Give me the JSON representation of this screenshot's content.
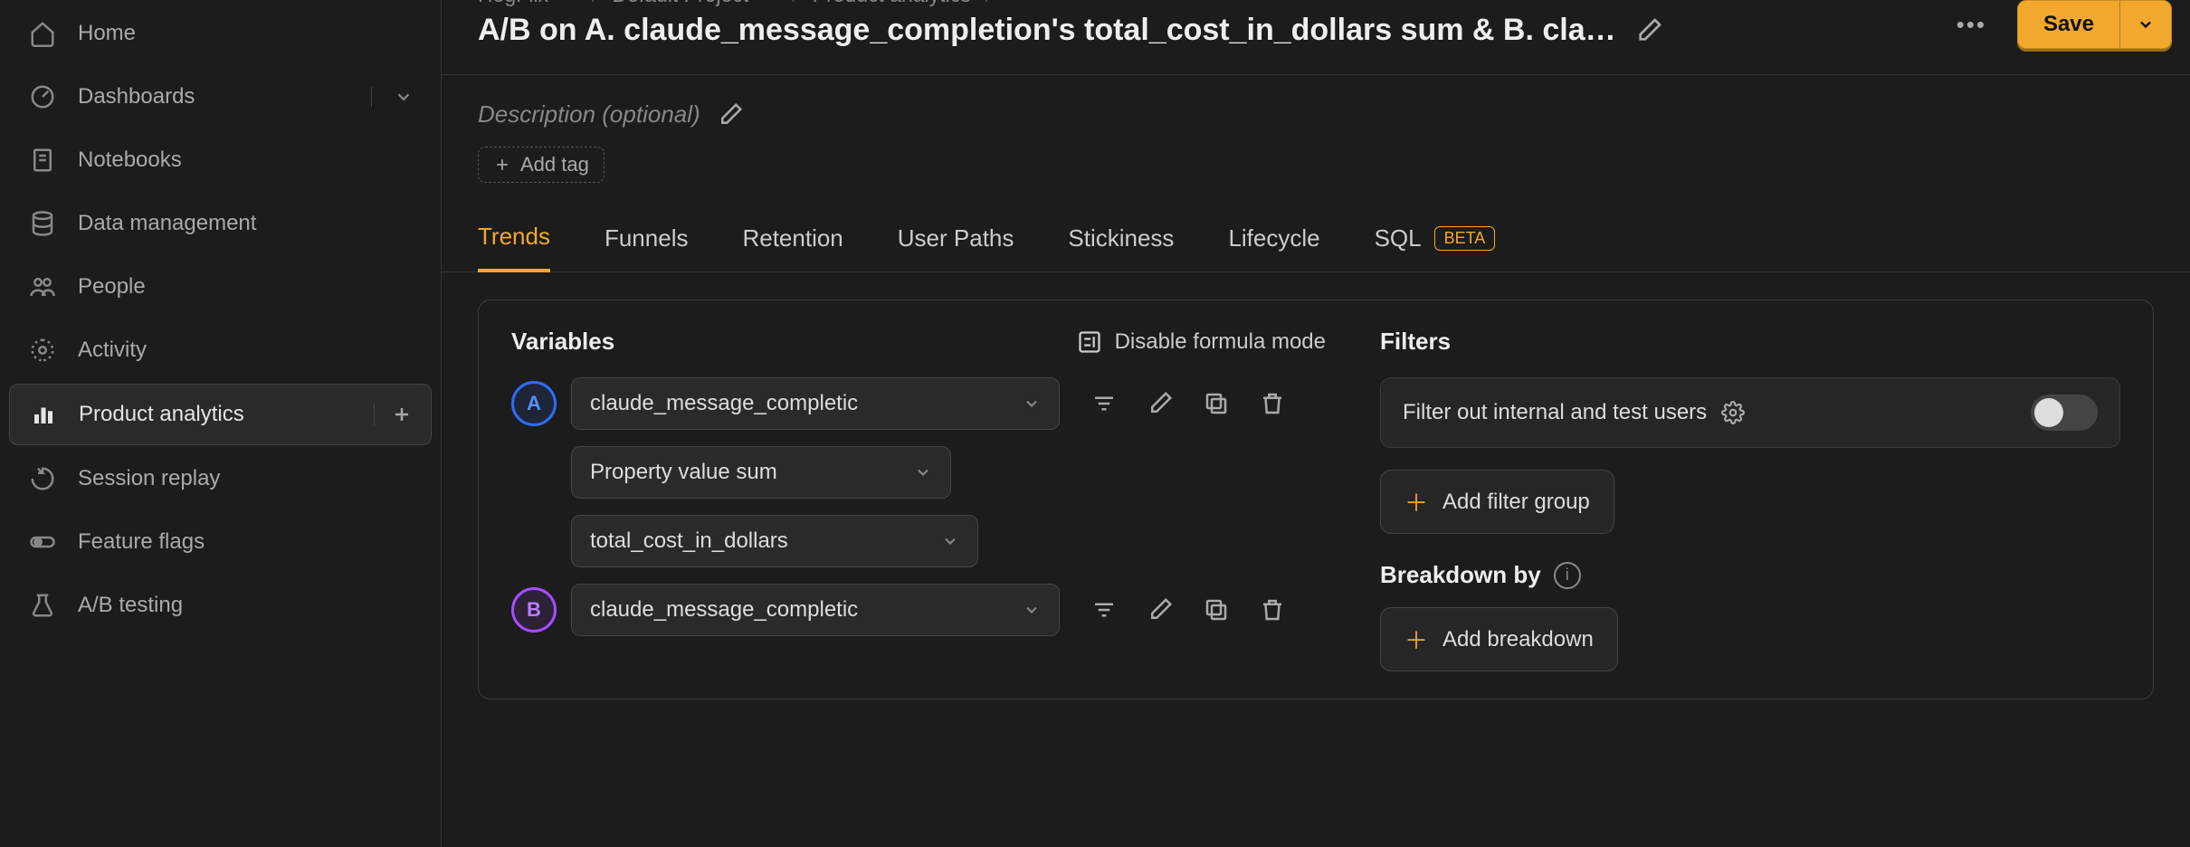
{
  "sidebar": {
    "items": [
      {
        "label": "Home"
      },
      {
        "label": "Dashboards"
      },
      {
        "label": "Notebooks"
      },
      {
        "label": "Data management"
      },
      {
        "label": "People"
      },
      {
        "label": "Activity"
      },
      {
        "label": "Product analytics"
      },
      {
        "label": "Session replay"
      },
      {
        "label": "Feature flags"
      },
      {
        "label": "A/B testing"
      }
    ]
  },
  "breadcrumb": {
    "org": "HogFlix",
    "project": "Default Project",
    "section": "Product analytics"
  },
  "title": "A/B on A. claude_message_completion's total_cost_in_dollars sum & B. cla…",
  "save_label": "Save",
  "description_placeholder": "Description (optional)",
  "add_tag_label": "Add tag",
  "tabs": [
    {
      "label": "Trends",
      "active": true
    },
    {
      "label": "Funnels"
    },
    {
      "label": "Retention"
    },
    {
      "label": "User Paths"
    },
    {
      "label": "Stickiness"
    },
    {
      "label": "Lifecycle"
    },
    {
      "label": "SQL",
      "badge": "BETA"
    }
  ],
  "variables": {
    "title": "Variables",
    "formula_toggle": "Disable formula mode",
    "series": [
      {
        "letter": "A",
        "event": "claude_message_completic",
        "aggregation": "Property value sum",
        "property": "total_cost_in_dollars"
      },
      {
        "letter": "B",
        "event": "claude_message_completic"
      }
    ]
  },
  "filters": {
    "title": "Filters",
    "internal_label": "Filter out internal and test users",
    "add_filter_group": "Add filter group",
    "breakdown_title": "Breakdown by",
    "add_breakdown": "Add breakdown"
  }
}
